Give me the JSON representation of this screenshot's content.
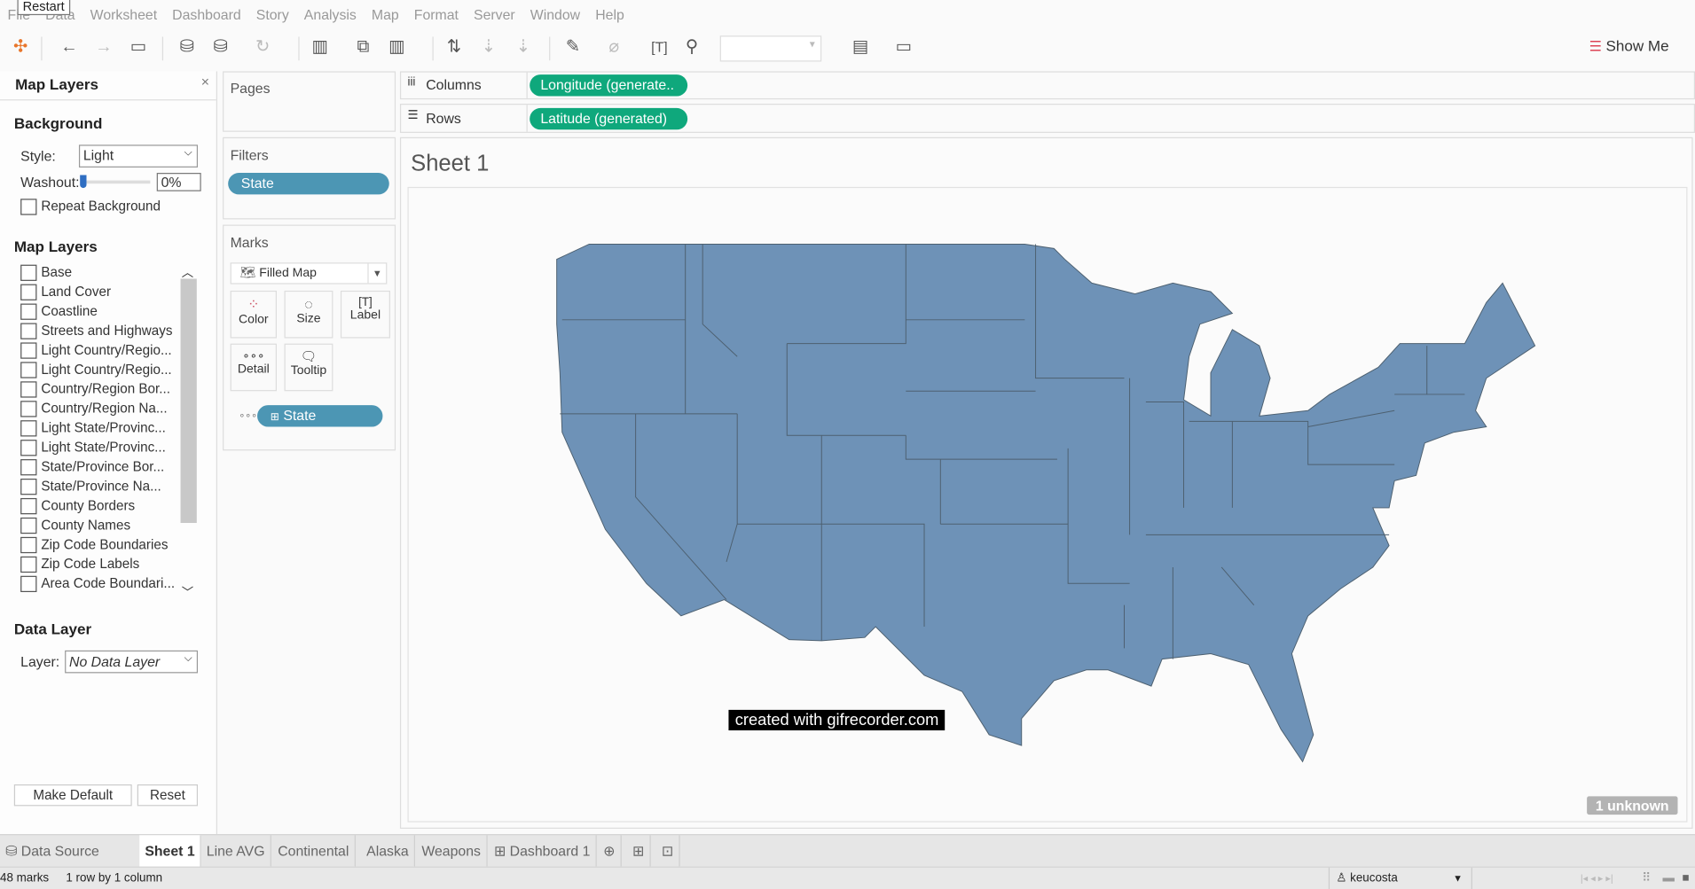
{
  "tooltip": "Restart",
  "menu": [
    "File",
    "Data",
    "Worksheet",
    "Dashboard",
    "Story",
    "Analysis",
    "Map",
    "Format",
    "Server",
    "Window",
    "Help"
  ],
  "toolbar": {
    "show_me": "Show Me"
  },
  "map_layers_panel": {
    "title": "Map Layers",
    "close": "×",
    "background_heading": "Background",
    "style_label": "Style:",
    "style_value": "Light",
    "washout_label": "Washout:",
    "washout_value": "0%",
    "washout_percent": 0,
    "repeat_background": "Repeat Background",
    "layers_heading": "Map Layers",
    "layers": [
      "Base",
      "Land Cover",
      "Coastline",
      "Streets and Highways",
      "Light Country/Regio...",
      "Light Country/Regio...",
      "Country/Region Bor...",
      "Country/Region Na...",
      "Light State/Provinc...",
      "Light State/Provinc...",
      "State/Province Bor...",
      "State/Province Na...",
      "County Borders",
      "County Names",
      "Zip Code Boundaries",
      "Zip Code Labels",
      "Area Code Boundari..."
    ],
    "data_layer_heading": "Data Layer",
    "layer_label": "Layer:",
    "layer_value": "No Data Layer",
    "make_default": "Make Default",
    "reset": "Reset"
  },
  "cards": {
    "pages": "Pages",
    "filters": "Filters",
    "filter_pill": "State",
    "marks": "Marks",
    "mark_type": "Filled Map",
    "mark_buttons": [
      "Color",
      "Size",
      "Label",
      "Detail",
      "Tooltip"
    ],
    "detail_pill": "State"
  },
  "shelves": {
    "columns_label": "Columns",
    "columns_pill": "Longitude (generate..",
    "rows_label": "Rows",
    "rows_pill": "Latitude (generated)"
  },
  "sheet": {
    "title": "Sheet 1",
    "unknown_badge": "1 unknown",
    "watermark": "created with gifrecorder.com",
    "map_fill": "#6e92b7"
  },
  "tabs": [
    "Data Source",
    "Sheet 1",
    "Line AVG",
    "Continental",
    "Alaska",
    "Weapons",
    "Dashboard 1"
  ],
  "status": {
    "marks": "48 marks",
    "dims": "1 row by 1 column",
    "user": "keucosta"
  }
}
